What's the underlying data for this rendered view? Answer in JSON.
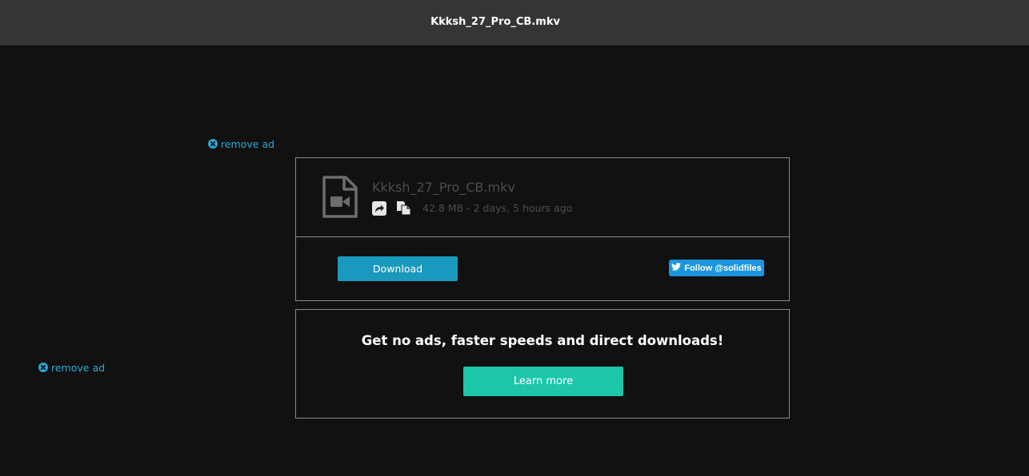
{
  "header": {
    "title": "Kkksh_27_Pro_CB.mkv"
  },
  "ads": {
    "remove_ad_top": "remove ad",
    "remove_ad_side": "remove ad",
    "icon": "close-circle-icon"
  },
  "file": {
    "name": "Kkksh_27_Pro_CB.mkv",
    "meta": "42.8 MB - 2 days, 5 hours ago",
    "type_icon": "video-file-icon",
    "share_icon": "share-icon",
    "copy_icon": "copy-icon"
  },
  "actions": {
    "download_label": "Download",
    "twitter_follow_label": "Follow @solidfiles",
    "twitter_icon": "twitter-bird-icon"
  },
  "promo": {
    "heading": "Get no ads, faster speeds and direct downloads!",
    "learn_more_label": "Learn more"
  },
  "colors": {
    "background": "#111111",
    "topbar": "#353535",
    "link": "#2aa7d8",
    "download_button": "#1a99be",
    "learn_more_button": "#1dc6a8",
    "twitter_button": "#1b95e0",
    "muted_text": "#4d4d4d"
  }
}
